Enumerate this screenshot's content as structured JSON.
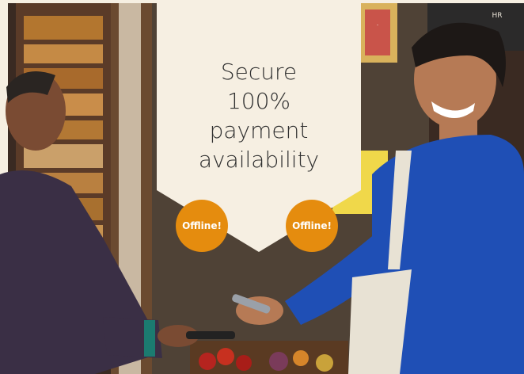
{
  "headline": {
    "line1": "Secure",
    "line2": "100%",
    "line3": "payment",
    "line4": "availability"
  },
  "badges": [
    {
      "label": "Offline!"
    },
    {
      "label": "Offline!"
    }
  ],
  "poster_sign": "HR",
  "colors": {
    "banner": "#f6efe2",
    "badge": "#e58c0e",
    "sweater": "#1f4fb5"
  }
}
